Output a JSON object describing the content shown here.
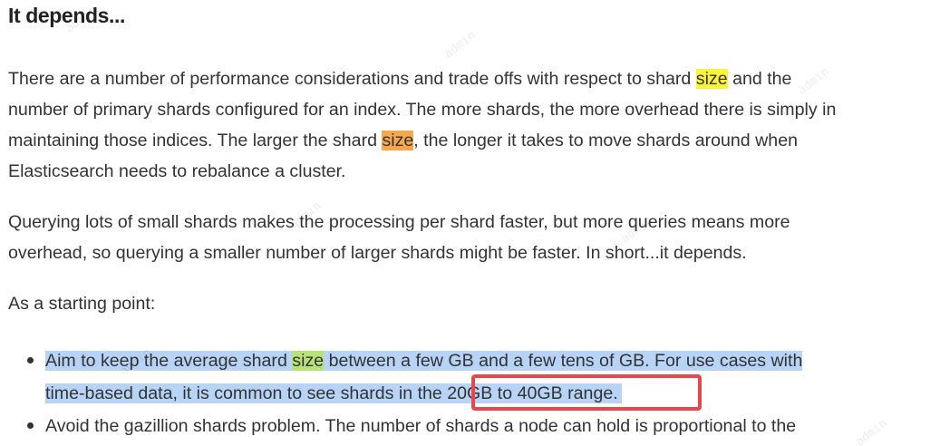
{
  "heading": "It depends...",
  "paragraph1": {
    "l1_before": "There are a number of performance considerations and trade offs with respect to shard ",
    "l1_hl": "size",
    "l1_after": " and the",
    "l2": "number of primary shards configured for an index. The more shards, the more overhead there is simply in",
    "l3_before": "maintaining those indices. The larger the shard ",
    "l3_hl": "size",
    "l3_after": ", the longer it takes to move shards around when",
    "l4": "Elasticsearch needs to rebalance a cluster."
  },
  "paragraph2": {
    "l1": "Querying lots of small shards makes the processing per shard faster, but more queries means more",
    "l2": "overhead, so querying a smaller number of larger shards might be faster. In short...it depends."
  },
  "paragraph3": "As a starting point:",
  "bullets": [
    {
      "l1_before": "Aim to keep the average shard ",
      "l1_hl": "size",
      "l1_after": " between a few GB and a few tens of GB. For use cases with",
      "l2": "time-based data, it is common to see shards in the 20GB to 40GB range."
    },
    {
      "l1": "Avoid the gazillion shards problem. The number of shards a node can hold is proportional to the"
    }
  ],
  "watermark_text": "admin",
  "colors": {
    "highlight_yellow": "#fbf53a",
    "highlight_orange": "#f7a84c",
    "highlight_green": "#b7e27a",
    "selection_blue": "#b7d3f5",
    "annotation_red": "#e8474c"
  }
}
